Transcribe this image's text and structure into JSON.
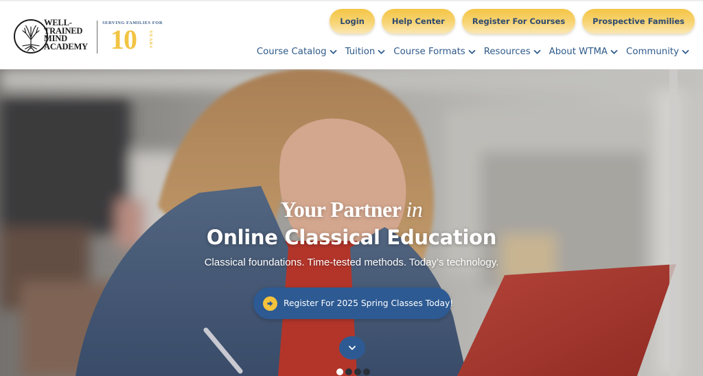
{
  "brand": {
    "name_lines": [
      "WELL-",
      "TRAINED",
      "MIND",
      "ACADEMY"
    ],
    "tagline": "SERVING FAMILIES FOR",
    "years_number": "10",
    "years_label": "YEARS",
    "accent_gold": "#f2c443",
    "accent_blue": "#2d5a93"
  },
  "utility_nav": [
    {
      "label": "Login"
    },
    {
      "label": "Help Center"
    },
    {
      "label": "Register For Courses"
    },
    {
      "label": "Prospective Families"
    }
  ],
  "main_nav": [
    {
      "label": "Course Catalog",
      "icon": "chevron-down-icon"
    },
    {
      "label": "Tuition",
      "icon": "chevron-down-icon"
    },
    {
      "label": "Course Formats",
      "icon": "chevron-down-icon"
    },
    {
      "label": "Resources",
      "icon": "chevron-down-icon"
    },
    {
      "label": "About WTMA",
      "icon": "chevron-down-icon"
    },
    {
      "label": "Community",
      "icon": "chevron-down-icon"
    }
  ],
  "hero": {
    "kicker_main": "Your Partner",
    "kicker_em": "in",
    "title": "Online Classical Education",
    "subtitle": "Classical foundations. Time-tested methods. Today’s technology.",
    "cta_label": "Register For 2025 Spring Classes Today!",
    "cta_icon": "arrow-right-circle-icon",
    "scroll_icon": "chevron-down-icon",
    "slides_total": 4,
    "slide_active": 1
  }
}
